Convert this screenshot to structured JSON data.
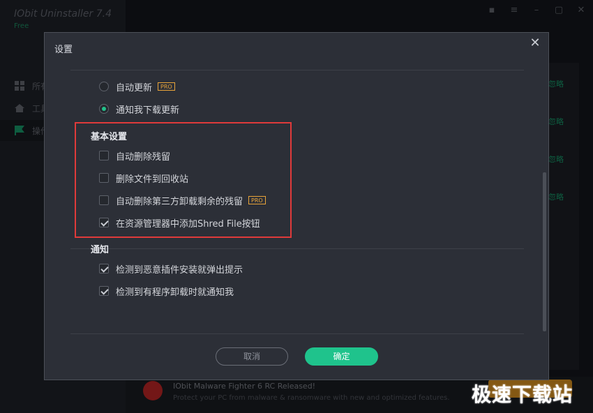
{
  "background_app": {
    "title": "IObit Uninstaller 7.4",
    "subtitle": "Free",
    "sidebar": [
      {
        "label": "所有"
      },
      {
        "label": "工具"
      },
      {
        "label": "操作"
      }
    ],
    "window_controls": [
      "briefcase-icon",
      "menu-icon",
      "minimize-icon",
      "restore-icon",
      "close-icon"
    ],
    "links": [
      "忽略",
      "忽略",
      "忽略",
      "忽略"
    ],
    "news_title": "IObit Malware Fighter 6 RC Released!",
    "news_sub": "Protect your PC from malware & ransomware with new and optimized features."
  },
  "watermark": "极速下载站",
  "dialog": {
    "title": "设置",
    "update": {
      "auto_update": {
        "label": "自动更新",
        "checked": false,
        "badge": "PRO"
      },
      "notify_download": {
        "label": "通知我下载更新",
        "checked": true
      }
    },
    "basic": {
      "title": "基本设置",
      "items": [
        {
          "label": "自动删除残留",
          "checked": false
        },
        {
          "label": "删除文件到回收站",
          "checked": false
        },
        {
          "label": "自动删除第三方卸载剩余的残留",
          "checked": false,
          "badge": "PRO"
        },
        {
          "label": "在资源管理器中添加Shred File按钮",
          "checked": true
        }
      ]
    },
    "notify": {
      "title": "通知",
      "items": [
        {
          "label": "检测到恶意插件安装就弹出提示",
          "checked": true
        },
        {
          "label": "检测到有程序卸载时就通知我",
          "checked": true
        }
      ]
    },
    "cancel_label": "取消",
    "ok_label": "确定"
  },
  "colors": {
    "accent": "#1fc38c",
    "highlight_box": "#e03a3a",
    "pro_badge": "#e8a43a"
  }
}
